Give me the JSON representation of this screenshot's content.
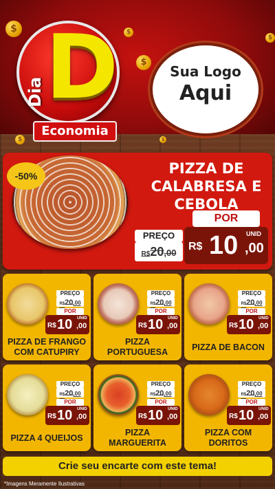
{
  "header": {
    "badge": {
      "dia": "Dia",
      "letter": "D",
      "ribbon": "Economia"
    },
    "logo_placeholder": {
      "line1": "Sua Logo",
      "line2": "Aqui"
    },
    "coin_symbol": "$"
  },
  "feature": {
    "discount": "-50%",
    "title_lines": [
      "PIZZA DE",
      "CALABRESA E",
      "CEBOLA"
    ],
    "preco_label": "PREÇO",
    "por_label": "POR",
    "old_price": {
      "currency": "R$",
      "integer": "20",
      "cents": ",00"
    },
    "new_price": {
      "currency": "R$",
      "integer": "10",
      "cents": ",00",
      "unit": "UNID"
    }
  },
  "products": [
    {
      "name_lines": [
        "PIZZA DE FRANGO",
        "COM CATUPIRY"
      ],
      "preco_label": "PREÇO",
      "por_label": "POR",
      "old_price": {
        "currency": "R$",
        "integer": "20",
        "cents": ",00"
      },
      "new_price": {
        "currency": "R$",
        "integer": "10",
        "cents": ",00",
        "unit": "UNID"
      }
    },
    {
      "name_lines": [
        "PIZZA",
        "PORTUGUESA"
      ],
      "preco_label": "PREÇO",
      "por_label": "POR",
      "old_price": {
        "currency": "R$",
        "integer": "20",
        "cents": ",00"
      },
      "new_price": {
        "currency": "R$",
        "integer": "10",
        "cents": ",00",
        "unit": "UNID"
      }
    },
    {
      "name_lines": [
        "PIZZA DE BACON"
      ],
      "preco_label": "PREÇO",
      "por_label": "POR",
      "old_price": {
        "currency": "R$",
        "integer": "20",
        "cents": ",00"
      },
      "new_price": {
        "currency": "R$",
        "integer": "10",
        "cents": ",00",
        "unit": "UNID"
      }
    },
    {
      "name_lines": [
        "PIZZA 4 QUEIJOS"
      ],
      "preco_label": "PREÇO",
      "por_label": "POR",
      "old_price": {
        "currency": "R$",
        "integer": "20",
        "cents": ",00"
      },
      "new_price": {
        "currency": "R$",
        "integer": "10",
        "cents": ",00",
        "unit": "UNID"
      }
    },
    {
      "name_lines": [
        "PIZZA",
        "MARGUERITA"
      ],
      "preco_label": "PREÇO",
      "por_label": "POR",
      "old_price": {
        "currency": "R$",
        "integer": "20",
        "cents": ",00"
      },
      "new_price": {
        "currency": "R$",
        "integer": "10",
        "cents": ",00",
        "unit": "UNID"
      }
    },
    {
      "name_lines": [
        "PIZZA COM",
        "DORITOS"
      ],
      "preco_label": "PREÇO",
      "por_label": "POR",
      "old_price": {
        "currency": "R$",
        "integer": "20",
        "cents": ",00"
      },
      "new_price": {
        "currency": "R$",
        "integer": "10",
        "cents": ",00",
        "unit": "UNID"
      }
    }
  ],
  "footer": {
    "cta": "Crie seu encarte com este tema!",
    "disclaimer": "*Imagens Meramente Ilustrativas"
  },
  "colors": {
    "red": "#d1190f",
    "yellow": "#f3b600",
    "dark_red": "#7a1408",
    "cta_yellow": "#f3d100"
  }
}
